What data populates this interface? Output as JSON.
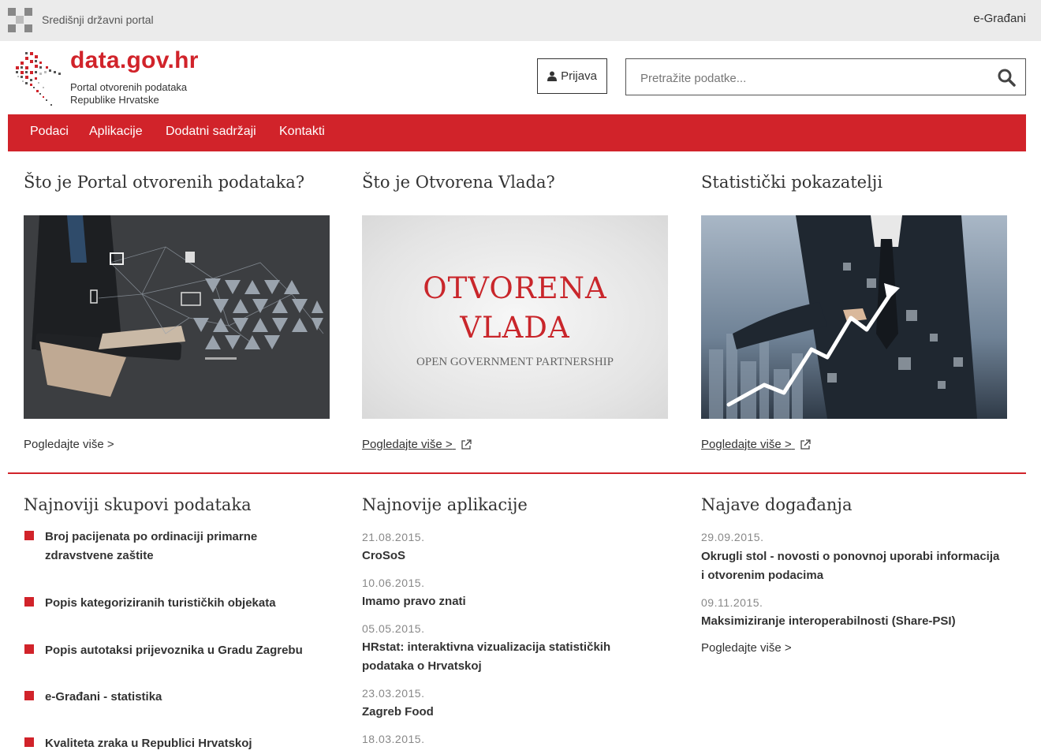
{
  "topbar": {
    "portal_name": "Središnji državni portal",
    "egradani": "e-Građani"
  },
  "header": {
    "logo_title": "data.gov.hr",
    "logo_sub_line1": "Portal otvorenih podataka",
    "logo_sub_line2": "Republike Hrvatske",
    "login_label": "Prijava",
    "search_placeholder": "Pretražite podatke..."
  },
  "nav": [
    "Podaci",
    "Aplikacije",
    "Dodatni sadržaji",
    "Kontakti"
  ],
  "features": [
    {
      "title": "Što je Portal otvorenih podataka?",
      "link": "Pogledajte više >"
    },
    {
      "title": "Što je Otvorena Vlada?",
      "link": "Pogledajte više >",
      "banner_line1": "OTVORENA",
      "banner_line2": "VLADA",
      "banner_sub": "OPEN GOVERNMENT PARTNERSHIP"
    },
    {
      "title": "Statistički pokazatelji",
      "link": "Pogledajte više >"
    }
  ],
  "datasets": {
    "title": "Najnoviji skupovi podataka",
    "items": [
      "Broj pacijenata po ordinaciji primarne zdravstvene zaštite",
      "Popis kategoriziranih turističkih objekata",
      "Popis autotaksi prijevoznika u Gradu Zagrebu",
      "e-Građani - statistika",
      "Kvaliteta zraka u Republici Hrvatskoj"
    ]
  },
  "apps": {
    "title": "Najnovije aplikacije",
    "items": [
      {
        "date": "21.08.2015.",
        "name": "CroSoS"
      },
      {
        "date": "10.06.2015.",
        "name": "Imamo pravo znati"
      },
      {
        "date": "05.05.2015.",
        "name": "HRstat: interaktivna vizualizacija statističkih podataka o Hrvatskoj"
      },
      {
        "date": "23.03.2015.",
        "name": "Zagreb Food"
      },
      {
        "date": "18.03.2015.",
        "name": ""
      }
    ]
  },
  "events": {
    "title": "Najave događanja",
    "items": [
      {
        "date": "29.09.2015.",
        "name": "Okrugli stol - novosti o ponovnoj uporabi informacija i otvorenim podacima"
      },
      {
        "date": "09.11.2015.",
        "name": "Maksimiziranje interoperabilnosti (Share-PSI)"
      }
    ],
    "more": "Pogledajte više >"
  },
  "colors": {
    "brand_red": "#d1232a",
    "topbar_bg": "#ebebeb"
  }
}
